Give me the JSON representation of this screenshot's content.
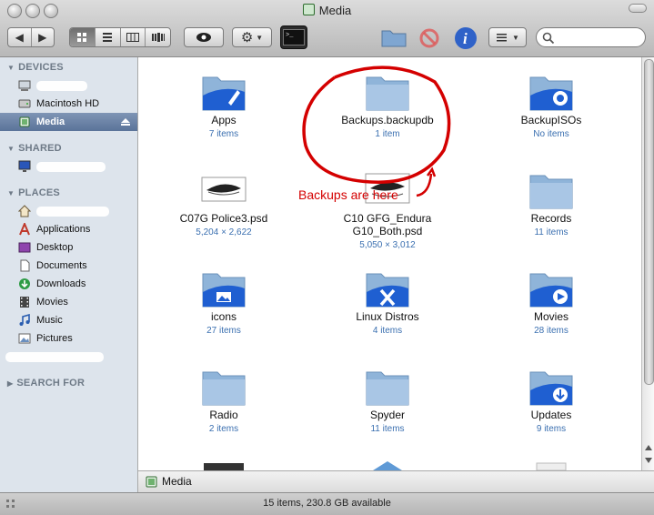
{
  "window": {
    "title": "Media",
    "status": "15 items, 230.8 GB available"
  },
  "sidebar": {
    "devices": {
      "heading": "DEVICES",
      "items": [
        {
          "label": "Macintosh HD"
        },
        {
          "label": "Media"
        }
      ]
    },
    "shared": {
      "heading": "SHARED"
    },
    "places": {
      "heading": "PLACES",
      "items": [
        {
          "label": "Applications"
        },
        {
          "label": "Desktop"
        },
        {
          "label": "Documents"
        },
        {
          "label": "Downloads"
        },
        {
          "label": "Movies"
        },
        {
          "label": "Music"
        },
        {
          "label": "Pictures"
        }
      ]
    },
    "search_for": {
      "heading": "SEARCH FOR"
    }
  },
  "content": {
    "items": [
      {
        "name": "Apps",
        "sub": "7 items",
        "icon": "apps-folder-icon"
      },
      {
        "name": "Backups.backupdb",
        "sub": "1 item",
        "icon": "folder-icon"
      },
      {
        "name": "BackupISOs",
        "sub": "No items",
        "icon": "backup-folder-icon"
      },
      {
        "name": "C07G Police3.psd",
        "sub": "5,204 × 2,622",
        "icon": "psd-thumbnail-icon"
      },
      {
        "name": "C10 GFG_Endura G10_Both.psd",
        "sub": "5,050 × 3,012",
        "icon": "psd-thumbnail-icon"
      },
      {
        "name": "Records",
        "sub": "11 items",
        "icon": "folder-icon"
      },
      {
        "name": "icons",
        "sub": "27 items",
        "icon": "pictures-folder-icon"
      },
      {
        "name": "Linux Distros",
        "sub": "4 items",
        "icon": "x-folder-icon"
      },
      {
        "name": "Movies",
        "sub": "28 items",
        "icon": "movies-folder-icon"
      },
      {
        "name": "Radio",
        "sub": "2 items",
        "icon": "folder-icon"
      },
      {
        "name": "Spyder",
        "sub": "11 items",
        "icon": "folder-icon"
      },
      {
        "name": "Updates",
        "sub": "9 items",
        "icon": "downloads-folder-icon"
      }
    ]
  },
  "annotation": {
    "text": "Backups are here"
  },
  "pathbar": {
    "label": "Media"
  },
  "colors": {
    "sidebar_bg": "#dde4ec",
    "selection": "#5a7399",
    "folder": "#8fb4d9",
    "annotation": "#d40000",
    "subtext": "#3a6fb0"
  }
}
